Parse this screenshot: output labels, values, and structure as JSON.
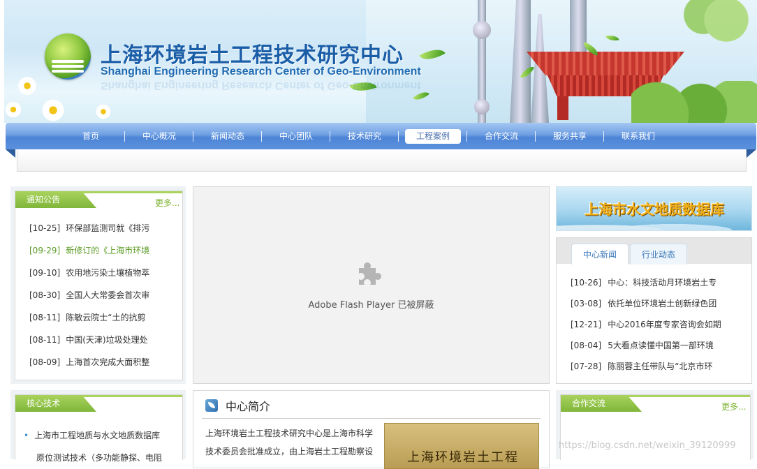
{
  "header": {
    "title_cn": "上海环境岩土工程技术研究中心",
    "title_en": "Shanghai Engineering Research Center of Geo-Environment"
  },
  "nav": {
    "items": [
      {
        "label": "首页"
      },
      {
        "label": "中心概况"
      },
      {
        "label": "新闻动态"
      },
      {
        "label": "中心团队"
      },
      {
        "label": "技术研究"
      },
      {
        "label": "工程案例",
        "active": true
      },
      {
        "label": "合作交流"
      },
      {
        "label": "服务共享"
      },
      {
        "label": "联系我们"
      }
    ]
  },
  "notice": {
    "title": "通知公告",
    "more": "更多...",
    "items": [
      {
        "date": "[10-25]",
        "text": "环保部监测司就《排污"
      },
      {
        "date": "[09-29]",
        "text": "新修订的《上海市环境",
        "highlight": true
      },
      {
        "date": "[09-10]",
        "text": "农用地污染土壤植物萃"
      },
      {
        "date": "[08-30]",
        "text": "全国人大常委会首次审"
      },
      {
        "date": "[08-11]",
        "text": "陈敏云院士“土的抗剪"
      },
      {
        "date": "[08-11]",
        "text": "中国(天津)垃圾处理处"
      },
      {
        "date": "[08-09]",
        "text": "上海首次完成大面积整"
      }
    ]
  },
  "flash": {
    "message": "Adobe Flash Player 已被屏蔽"
  },
  "hydro_banner": {
    "text": "上海市水文地质数据库"
  },
  "news_tabs": {
    "tabs": [
      {
        "label": "中心新闻",
        "active": true
      },
      {
        "label": "行业动态"
      }
    ],
    "items": [
      {
        "date": "[10-26]",
        "text": "中心：科技活动月环境岩土专"
      },
      {
        "date": "[03-08]",
        "text": "依托单位环境岩土创新绿色团"
      },
      {
        "date": "[12-21]",
        "text": "中心2016年度专家咨询会如期"
      },
      {
        "date": "[08-04]",
        "text": "5大看点读懂中国第一部环境"
      },
      {
        "date": "[07-28]",
        "text": "陈丽蓉主任带队与“北京市环"
      }
    ]
  },
  "core_tech": {
    "title": "核心技术",
    "items": [
      {
        "text": "上海市工程地质与水文地质数据库"
      },
      {
        "text": "原位测试技术（多功能静探、电阻"
      }
    ]
  },
  "intro": {
    "title": "中心简介",
    "text": "上海环境岩土工程技术研究中心是上海市科学技术委员会批准成立，由上海岩土工程勘察设",
    "image_text": "上海环境岩土工程"
  },
  "cooperation": {
    "title": "合作交流",
    "more": "更多..."
  },
  "watermark": "https://blog.csdn.net/weixin_39120999"
}
